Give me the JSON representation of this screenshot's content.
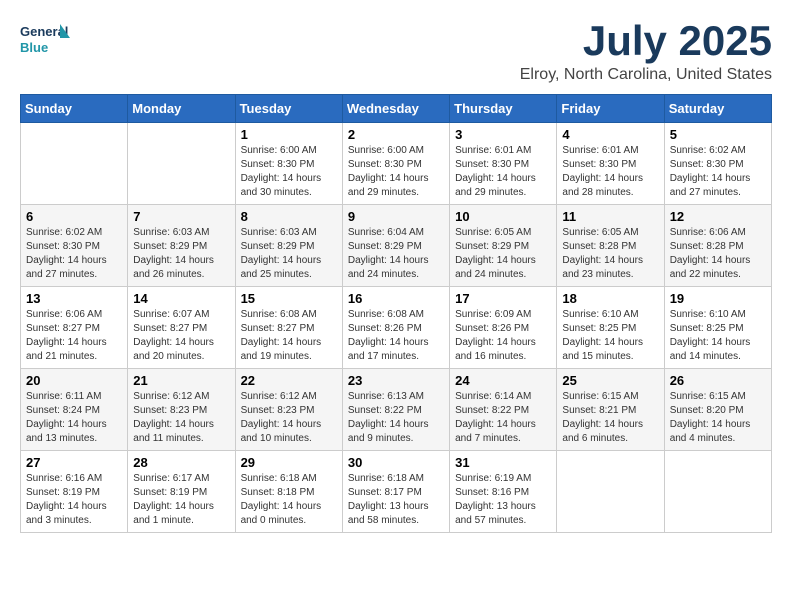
{
  "logo": {
    "line1": "General",
    "line2": "Blue"
  },
  "title": "July 2025",
  "location": "Elroy, North Carolina, United States",
  "weekdays": [
    "Sunday",
    "Monday",
    "Tuesday",
    "Wednesday",
    "Thursday",
    "Friday",
    "Saturday"
  ],
  "weeks": [
    [
      {
        "day": "",
        "info": ""
      },
      {
        "day": "",
        "info": ""
      },
      {
        "day": "1",
        "info": "Sunrise: 6:00 AM\nSunset: 8:30 PM\nDaylight: 14 hours\nand 30 minutes."
      },
      {
        "day": "2",
        "info": "Sunrise: 6:00 AM\nSunset: 8:30 PM\nDaylight: 14 hours\nand 29 minutes."
      },
      {
        "day": "3",
        "info": "Sunrise: 6:01 AM\nSunset: 8:30 PM\nDaylight: 14 hours\nand 29 minutes."
      },
      {
        "day": "4",
        "info": "Sunrise: 6:01 AM\nSunset: 8:30 PM\nDaylight: 14 hours\nand 28 minutes."
      },
      {
        "day": "5",
        "info": "Sunrise: 6:02 AM\nSunset: 8:30 PM\nDaylight: 14 hours\nand 27 minutes."
      }
    ],
    [
      {
        "day": "6",
        "info": "Sunrise: 6:02 AM\nSunset: 8:30 PM\nDaylight: 14 hours\nand 27 minutes."
      },
      {
        "day": "7",
        "info": "Sunrise: 6:03 AM\nSunset: 8:29 PM\nDaylight: 14 hours\nand 26 minutes."
      },
      {
        "day": "8",
        "info": "Sunrise: 6:03 AM\nSunset: 8:29 PM\nDaylight: 14 hours\nand 25 minutes."
      },
      {
        "day": "9",
        "info": "Sunrise: 6:04 AM\nSunset: 8:29 PM\nDaylight: 14 hours\nand 24 minutes."
      },
      {
        "day": "10",
        "info": "Sunrise: 6:05 AM\nSunset: 8:29 PM\nDaylight: 14 hours\nand 24 minutes."
      },
      {
        "day": "11",
        "info": "Sunrise: 6:05 AM\nSunset: 8:28 PM\nDaylight: 14 hours\nand 23 minutes."
      },
      {
        "day": "12",
        "info": "Sunrise: 6:06 AM\nSunset: 8:28 PM\nDaylight: 14 hours\nand 22 minutes."
      }
    ],
    [
      {
        "day": "13",
        "info": "Sunrise: 6:06 AM\nSunset: 8:27 PM\nDaylight: 14 hours\nand 21 minutes."
      },
      {
        "day": "14",
        "info": "Sunrise: 6:07 AM\nSunset: 8:27 PM\nDaylight: 14 hours\nand 20 minutes."
      },
      {
        "day": "15",
        "info": "Sunrise: 6:08 AM\nSunset: 8:27 PM\nDaylight: 14 hours\nand 19 minutes."
      },
      {
        "day": "16",
        "info": "Sunrise: 6:08 AM\nSunset: 8:26 PM\nDaylight: 14 hours\nand 17 minutes."
      },
      {
        "day": "17",
        "info": "Sunrise: 6:09 AM\nSunset: 8:26 PM\nDaylight: 14 hours\nand 16 minutes."
      },
      {
        "day": "18",
        "info": "Sunrise: 6:10 AM\nSunset: 8:25 PM\nDaylight: 14 hours\nand 15 minutes."
      },
      {
        "day": "19",
        "info": "Sunrise: 6:10 AM\nSunset: 8:25 PM\nDaylight: 14 hours\nand 14 minutes."
      }
    ],
    [
      {
        "day": "20",
        "info": "Sunrise: 6:11 AM\nSunset: 8:24 PM\nDaylight: 14 hours\nand 13 minutes."
      },
      {
        "day": "21",
        "info": "Sunrise: 6:12 AM\nSunset: 8:23 PM\nDaylight: 14 hours\nand 11 minutes."
      },
      {
        "day": "22",
        "info": "Sunrise: 6:12 AM\nSunset: 8:23 PM\nDaylight: 14 hours\nand 10 minutes."
      },
      {
        "day": "23",
        "info": "Sunrise: 6:13 AM\nSunset: 8:22 PM\nDaylight: 14 hours\nand 9 minutes."
      },
      {
        "day": "24",
        "info": "Sunrise: 6:14 AM\nSunset: 8:22 PM\nDaylight: 14 hours\nand 7 minutes."
      },
      {
        "day": "25",
        "info": "Sunrise: 6:15 AM\nSunset: 8:21 PM\nDaylight: 14 hours\nand 6 minutes."
      },
      {
        "day": "26",
        "info": "Sunrise: 6:15 AM\nSunset: 8:20 PM\nDaylight: 14 hours\nand 4 minutes."
      }
    ],
    [
      {
        "day": "27",
        "info": "Sunrise: 6:16 AM\nSunset: 8:19 PM\nDaylight: 14 hours\nand 3 minutes."
      },
      {
        "day": "28",
        "info": "Sunrise: 6:17 AM\nSunset: 8:19 PM\nDaylight: 14 hours\nand 1 minute."
      },
      {
        "day": "29",
        "info": "Sunrise: 6:18 AM\nSunset: 8:18 PM\nDaylight: 14 hours\nand 0 minutes."
      },
      {
        "day": "30",
        "info": "Sunrise: 6:18 AM\nSunset: 8:17 PM\nDaylight: 13 hours\nand 58 minutes."
      },
      {
        "day": "31",
        "info": "Sunrise: 6:19 AM\nSunset: 8:16 PM\nDaylight: 13 hours\nand 57 minutes."
      },
      {
        "day": "",
        "info": ""
      },
      {
        "day": "",
        "info": ""
      }
    ]
  ]
}
